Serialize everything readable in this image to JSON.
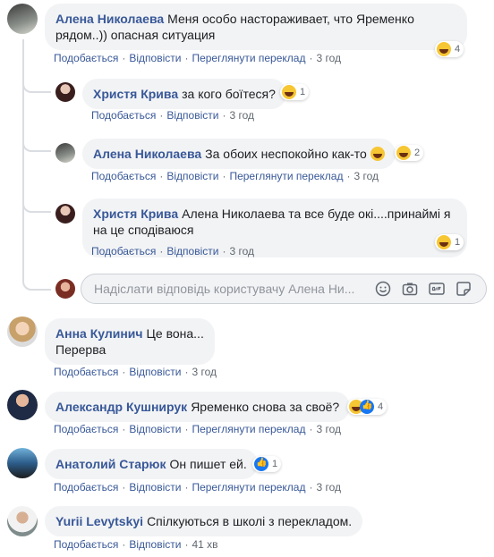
{
  "comments": [
    {
      "author": "Алена Николаева",
      "text": "Меня особо настораживает, что Яременко рядом..)) опасная ситуация",
      "actions": [
        "Подобається",
        "Відповісти",
        "Переглянути переклад"
      ],
      "time": "3 год",
      "reaction": {
        "icons": [
          "haha-icon"
        ],
        "count": "4"
      }
    },
    {
      "author": "Христя Крива",
      "text": "за кого боїтеся?",
      "actions": [
        "Подобається",
        "Відповісти"
      ],
      "time": "3 год",
      "reaction": {
        "icons": [
          "haha-icon"
        ],
        "count": "1"
      }
    },
    {
      "author": "Алена Николаева",
      "text": "За обоих неспокойно как-то",
      "actions": [
        "Подобається",
        "Відповісти",
        "Переглянути переклад"
      ],
      "time": "3 год",
      "reaction": {
        "icons": [
          "haha-icon"
        ],
        "count": "2"
      }
    },
    {
      "author": "Христя Крива",
      "text": "Алена Николаева та все буде окі....принаймі я на це сподіваюся",
      "actions": [
        "Подобається",
        "Відповісти"
      ],
      "time": "3 год",
      "reaction": {
        "icons": [
          "haha-icon"
        ],
        "count": "1"
      }
    },
    {
      "author": "Анна Кулинич",
      "text": "Це вона... Перерва",
      "actions": [
        "Подобається",
        "Відповісти"
      ],
      "time": "3 год"
    },
    {
      "author": "Александр Кушнирук",
      "text": "Яременко снова за своё?",
      "actions": [
        "Подобається",
        "Відповісти",
        "Переглянути переклад"
      ],
      "time": "3 год",
      "reaction": {
        "icons": [
          "haha-icon",
          "like-icon"
        ],
        "count": "4"
      }
    },
    {
      "author": "Анатолий Старюк",
      "text": "Он пишет ей.",
      "actions": [
        "Подобається",
        "Відповісти",
        "Переглянути переклад"
      ],
      "time": "3 год",
      "reaction": {
        "icons": [
          "like-icon"
        ],
        "count": "1"
      }
    },
    {
      "author": "Yurii Levytskyi",
      "text": "Спілкуються в школі з перекладом.",
      "actions": [
        "Подобається",
        "Відповісти"
      ],
      "time": "41 хв"
    }
  ],
  "reply_input": {
    "placeholder": "Надіслати відповідь користувачу Алена Ни...",
    "icons": [
      "emoji-icon",
      "camera-icon",
      "gif-icon",
      "sticker-icon"
    ]
  },
  "colors": {
    "link": "#385898",
    "bubble": "#f2f3f5",
    "meta": "#606770"
  }
}
